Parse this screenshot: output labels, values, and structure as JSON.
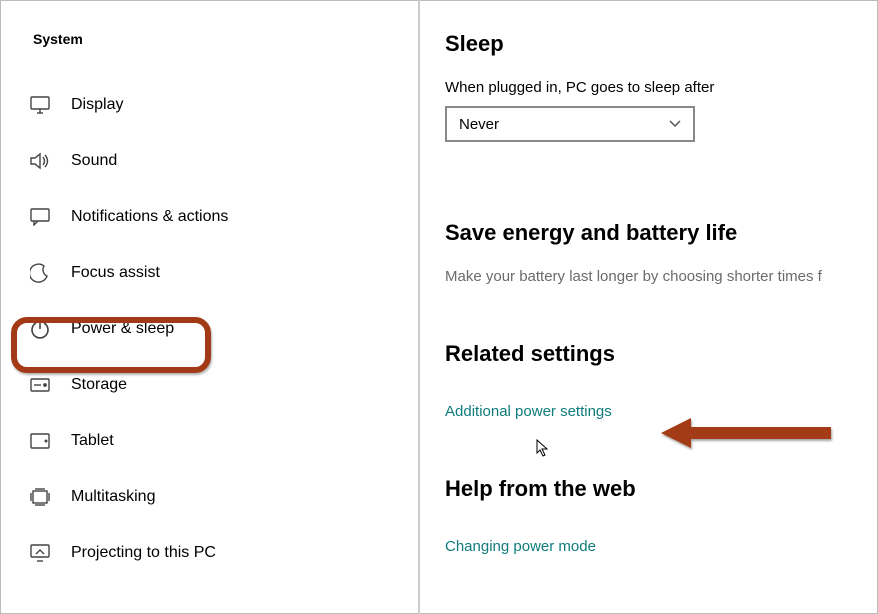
{
  "sidebar": {
    "title": "System",
    "items": [
      {
        "label": "Display"
      },
      {
        "label": "Sound"
      },
      {
        "label": "Notifications & actions"
      },
      {
        "label": "Focus assist"
      },
      {
        "label": "Power & sleep"
      },
      {
        "label": "Storage"
      },
      {
        "label": "Tablet"
      },
      {
        "label": "Multitasking"
      },
      {
        "label": "Projecting to this PC"
      }
    ]
  },
  "main": {
    "sleep": {
      "heading": "Sleep",
      "field_label": "When plugged in, PC goes to sleep after",
      "dropdown_value": "Never"
    },
    "energy": {
      "heading": "Save energy and battery life",
      "desc": "Make your battery last longer by choosing shorter times f"
    },
    "related": {
      "heading": "Related settings",
      "link": "Additional power settings"
    },
    "help": {
      "heading": "Help from the web",
      "link": "Changing power mode"
    }
  }
}
